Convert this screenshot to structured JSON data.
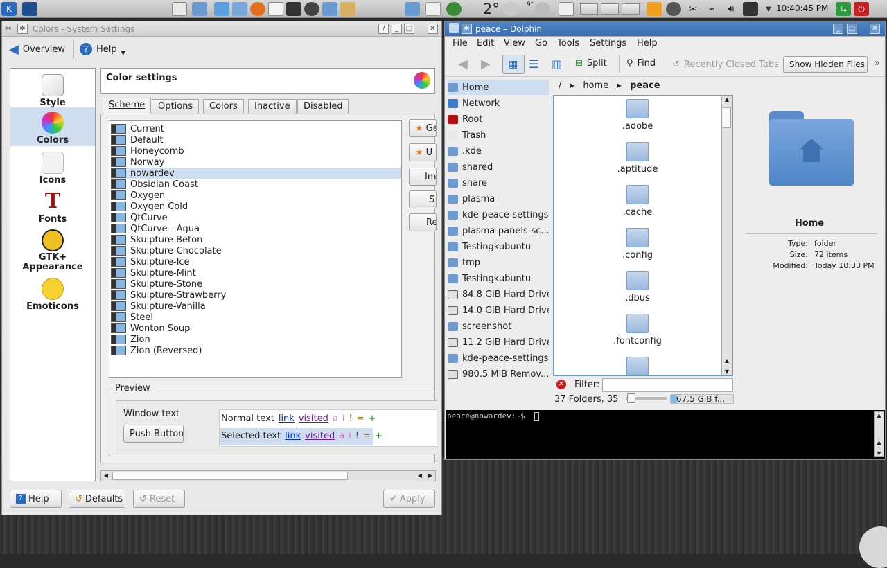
{
  "panel": {
    "temperature": "2°",
    "weather_small": "9°",
    "clock": "10:40:45 PM"
  },
  "settings": {
    "title": "Colors - System Settings",
    "toolbar": {
      "overview": "Overview",
      "help": "Help"
    },
    "categories": [
      "Style",
      "Colors",
      "Icons",
      "Fonts",
      "GTK+ Appearance",
      "Emoticons"
    ],
    "heading": "Color settings",
    "tabs": [
      "Scheme",
      "Options",
      "Colors",
      "Inactive",
      "Disabled"
    ],
    "schemes": [
      "Current",
      "Default",
      "Honeycomb",
      "Norway",
      "nowardev",
      "Obsidian Coast",
      "Oxygen",
      "Oxygen Cold",
      "QtCurve",
      "QtCurve - Agua",
      "Skulpture-Beton",
      "Skulpture-Chocolate",
      "Skulpture-Ice",
      "Skulpture-Mint",
      "Skulpture-Stone",
      "Skulpture-Strawberry",
      "Skulpture-Vanilla",
      "Steel",
      "Wonton Soup",
      "Zion",
      "Zion (Reversed)"
    ],
    "selected_scheme": "nowardev",
    "side_buttons": [
      "Ge",
      "U",
      "Im",
      "S",
      "Re"
    ],
    "preview": {
      "label": "Preview",
      "window_text": "Window text",
      "push_button": "Push Button",
      "normal_text": "Normal text",
      "selected_text": "Selected text",
      "link": "link",
      "visited": "visited",
      "a": "a",
      "i": "i",
      "bang": "!",
      "eq": "=",
      "plus": "+"
    },
    "footer": {
      "help": "Help",
      "defaults": "Defaults",
      "reset": "Reset",
      "apply": "Apply"
    }
  },
  "dolphin": {
    "title": "peace – Dolphin",
    "menu": [
      "File",
      "Edit",
      "View",
      "Go",
      "Tools",
      "Settings",
      "Help"
    ],
    "toolbar": {
      "split": "Split",
      "find": "Find",
      "recently_closed": "Recently Closed Tabs",
      "show_hidden": "Show Hidden Files"
    },
    "places": [
      "Home",
      "Network",
      "Root",
      "Trash",
      ".kde",
      "shared",
      "share",
      "plasma",
      "kde-peace-settings",
      "plasma-panels-sc...",
      "Testingkubuntu",
      "tmp",
      "Testingkubuntu",
      "84.8 GiB Hard Drive",
      "14.0 GiB Hard Drive",
      "screenshot",
      "11.2 GiB Hard Drive",
      "kde-peace-settings",
      "980.5 MiB Remov..."
    ],
    "breadcrumb": {
      "root": "/",
      "home": "home",
      "current": "peace"
    },
    "folders": [
      ".adobe",
      ".aptitude",
      ".cache",
      ".config",
      ".dbus",
      ".fontconfig"
    ],
    "filter_label": "Filter:",
    "status": "37 Folders, 35",
    "free_space": "67.5 GiB f...",
    "info": {
      "name": "Home",
      "type_label": "Type:",
      "type": "folder",
      "size_label": "Size:",
      "size": "72 items",
      "modified_label": "Modified:",
      "modified": "Today 10:33 PM"
    }
  },
  "terminal": {
    "prompt": "peace@nowardev:~$"
  }
}
